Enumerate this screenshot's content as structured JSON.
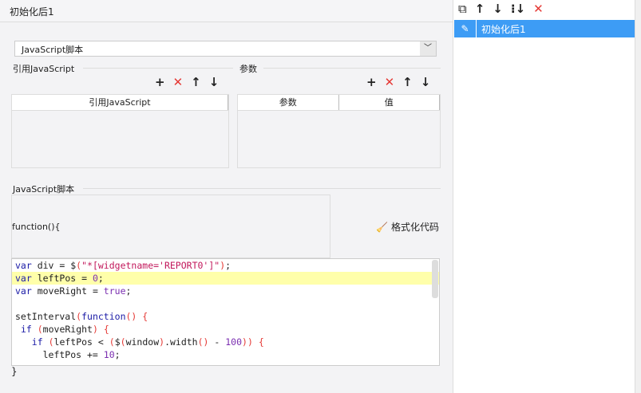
{
  "header": {
    "title": "初始化后1"
  },
  "dropdown": {
    "value": "JavaScript脚本"
  },
  "ref_section": {
    "label": "引用JavaScript",
    "column": "引用JavaScript"
  },
  "param_section": {
    "label": "参数",
    "columns": [
      "参数",
      "值"
    ]
  },
  "script_section": {
    "label": "JavaScript脚本",
    "prefix": "function(){",
    "suffix": "}",
    "format_button": "格式化代码"
  },
  "code_lines": [
    "var div = $(\"*[widgetname='REPORT0']\");",
    "var leftPos = 0;",
    "var moveRight = true;",
    "",
    "setInterval(function() {",
    " if (moveRight) {",
    "   if (leftPos < ($(window).width() - 100)) {",
    "     leftPos += 10;"
  ],
  "right_panel": {
    "items": [
      {
        "label": "初始化后1",
        "selected": true
      }
    ]
  }
}
